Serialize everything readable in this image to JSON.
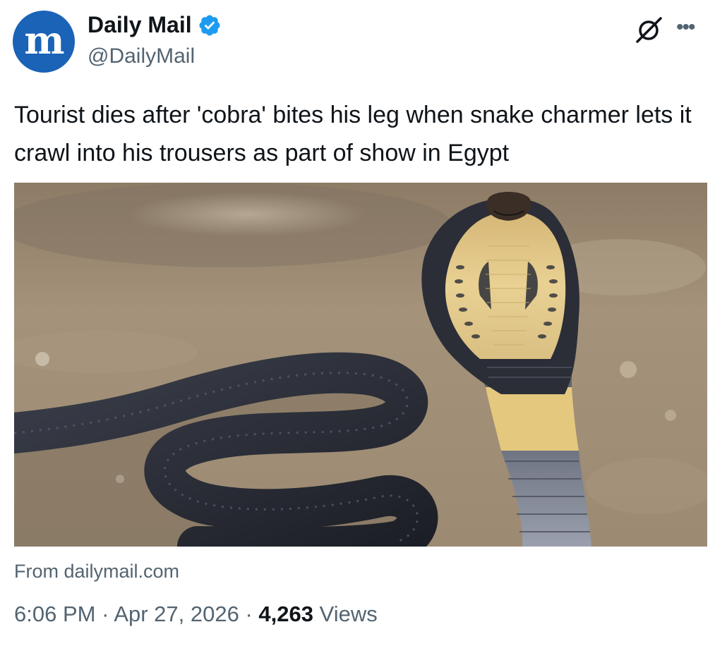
{
  "account": {
    "display_name": "Daily Mail",
    "handle": "@DailyMail",
    "avatar_glyph": "m",
    "verified": true,
    "avatar_color": "#1a63b7",
    "verified_color": "#1d9bf0"
  },
  "tweet": {
    "text": "Tourist dies after 'cobra' bites his leg when snake charmer lets it crawl into his trousers as part of show in Egypt",
    "media_subject": "cobra",
    "source": "From dailymail.com",
    "time": "6:06 PM",
    "separator": "·",
    "date": "Apr 27, 2026",
    "views_count": "4,263",
    "views_label": "Views"
  },
  "icons": {
    "grok": "grok-icon",
    "more": "more-options-icon",
    "verified": "verified-badge-icon"
  }
}
